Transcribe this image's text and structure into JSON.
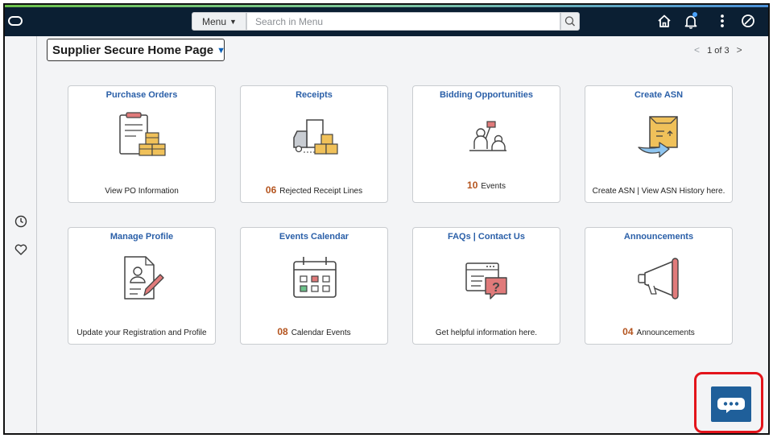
{
  "header": {
    "menu_label": "Menu",
    "search_placeholder": "Search in Menu"
  },
  "page": {
    "title": "Supplier Secure Home Page",
    "pager": "1 of 3"
  },
  "tiles": [
    {
      "title": "Purchase Orders",
      "count": "",
      "footer": "View PO Information",
      "icon": "clipboard-boxes-icon"
    },
    {
      "title": "Receipts",
      "count": "06",
      "footer": "Rejected Receipt Lines",
      "icon": "delivery-truck-icon"
    },
    {
      "title": "Bidding Opportunities",
      "count": "10",
      "footer": "Events",
      "icon": "bidding-people-icon"
    },
    {
      "title": "Create ASN",
      "count": "",
      "footer": "Create ASN | View ASN History here.",
      "icon": "package-arrow-icon"
    },
    {
      "title": "Manage Profile",
      "count": "",
      "footer": "Update your Registration and Profile",
      "icon": "profile-edit-icon"
    },
    {
      "title": "Events Calendar",
      "count": "08",
      "footer": "Calendar Events",
      "icon": "calendar-icon"
    },
    {
      "title": "FAQs | Contact Us",
      "count": "",
      "footer": "Get helpful information here.",
      "icon": "faq-question-icon"
    },
    {
      "title": "Announcements",
      "count": "04",
      "footer": "Announcements",
      "icon": "megaphone-icon"
    }
  ],
  "colors": {
    "topbar": "#0b1f33",
    "tile_title": "#2a5fa8",
    "count": "#b4541e",
    "chat_button": "#1f5f9a",
    "highlight": "#e3141b"
  }
}
